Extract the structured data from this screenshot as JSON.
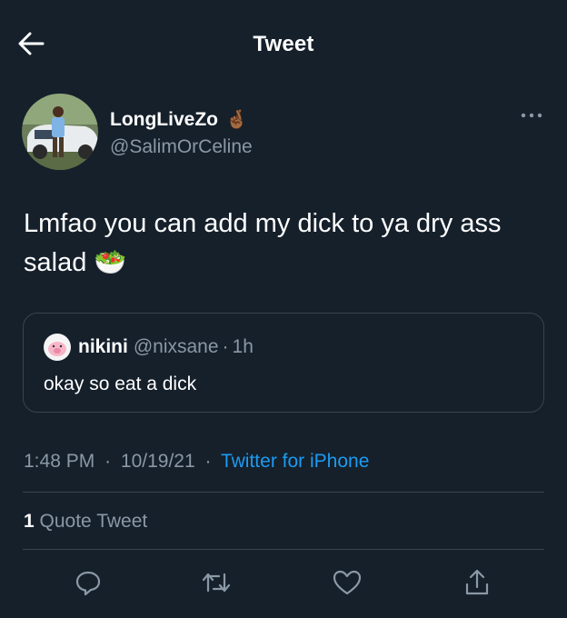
{
  "header": {
    "title": "Tweet"
  },
  "author": {
    "display_name": "LongLiveZo",
    "handle": "@SalimOrCeline",
    "emoji": "🤞🏾"
  },
  "tweet": {
    "text": "Lmfao you can add my dick to ya dry ass salad",
    "emoji": "🥗"
  },
  "quote": {
    "name": "nikini",
    "handle": "@nixsane",
    "separator": "·",
    "time": "1h",
    "text": "okay so eat a dick"
  },
  "meta": {
    "time": "1:48 PM",
    "separator1": "·",
    "date": "10/19/21",
    "separator2": "·",
    "source": "Twitter for iPhone"
  },
  "stats": {
    "quote_count": "1",
    "quote_label": "Quote Tweet"
  },
  "actions": [
    "reply-icon",
    "retweet-icon",
    "like-icon",
    "share-icon"
  ],
  "colors": {
    "background": "#15202b",
    "text": "#ffffff",
    "secondary": "#8b98a5",
    "accent": "#1d9bf0",
    "border": "#38444d"
  }
}
